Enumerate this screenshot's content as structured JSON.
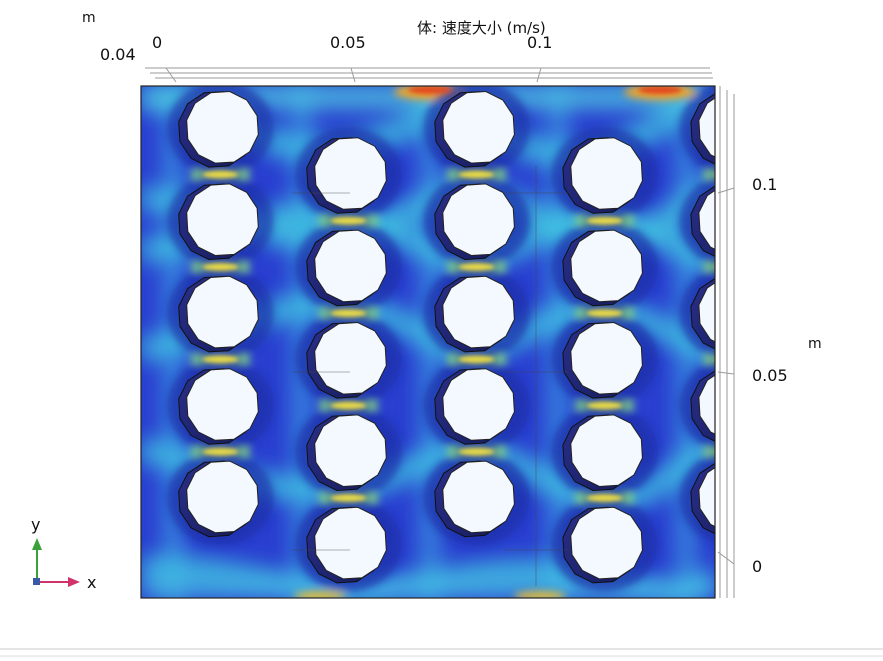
{
  "chart_data": {
    "type": "heatmap",
    "title": "体: 速度大小 (m/s)",
    "colormap": "rainbow",
    "x_axis": {
      "unit": "m",
      "ticks": [
        "0",
        "0.05",
        "0.1"
      ],
      "tick_values": [
        0,
        0.05,
        0.1
      ],
      "range": [
        0,
        0.13
      ]
    },
    "y_axis": {
      "unit": "m",
      "ticks": [
        "0",
        "0.05",
        "0.1"
      ],
      "tick_values": [
        0,
        0.05,
        0.1
      ],
      "range": [
        -0.008,
        0.125
      ]
    },
    "z_axis": {
      "unit": "m",
      "ticks": [
        "0.04"
      ]
    },
    "triad": {
      "x": "x",
      "y": "y"
    },
    "obstacles": [
      {
        "x": 0.018,
        "y": 0.114
      },
      {
        "x": 0.018,
        "y": 0.09
      },
      {
        "x": 0.018,
        "y": 0.066
      },
      {
        "x": 0.018,
        "y": 0.042
      },
      {
        "x": 0.018,
        "y": 0.018
      },
      {
        "x": 0.047,
        "y": 0.102
      },
      {
        "x": 0.047,
        "y": 0.078
      },
      {
        "x": 0.047,
        "y": 0.054
      },
      {
        "x": 0.047,
        "y": 0.03
      },
      {
        "x": 0.047,
        "y": 0.006
      },
      {
        "x": 0.076,
        "y": 0.114
      },
      {
        "x": 0.076,
        "y": 0.09
      },
      {
        "x": 0.076,
        "y": 0.066
      },
      {
        "x": 0.076,
        "y": 0.042
      },
      {
        "x": 0.076,
        "y": 0.018
      },
      {
        "x": 0.105,
        "y": 0.102
      },
      {
        "x": 0.105,
        "y": 0.078
      },
      {
        "x": 0.105,
        "y": 0.054
      },
      {
        "x": 0.105,
        "y": 0.03
      },
      {
        "x": 0.105,
        "y": 0.006
      },
      {
        "x": 0.134,
        "y": 0.114
      },
      {
        "x": 0.134,
        "y": 0.09
      },
      {
        "x": 0.134,
        "y": 0.066
      },
      {
        "x": 0.134,
        "y": 0.042
      },
      {
        "x": 0.134,
        "y": 0.018
      }
    ],
    "obstacle_radius": 0.0085
  }
}
